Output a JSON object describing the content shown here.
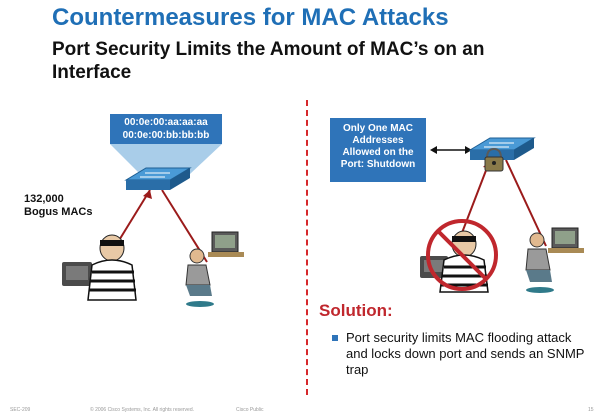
{
  "slide": {
    "title": "Countermeasures for MAC Attacks",
    "subtitle": "Port Security Limits the Amount of MAC’s on an Interface"
  },
  "left_panel": {
    "mac_table": [
      "00:0e:00:aa:aa:aa",
      "00:0e:00:bb:bb:bb"
    ],
    "attack_label_line1": "132,000",
    "attack_label_line2": "Bogus MACs"
  },
  "right_panel": {
    "callout_lines": [
      "Only One MAC",
      "Addresses",
      "Allowed on the",
      "Port: Shutdown"
    ],
    "solution_heading": "Solution:",
    "solution_bullet": "Port security limits MAC flooding attack and locks down port and sends an SNMP trap"
  },
  "footer": {
    "code": "SEC-209",
    "copyright": "© 2006 Cisco Systems, Inc. All rights reserved.",
    "classification": "Cisco Public",
    "page_number": "15"
  },
  "colors": {
    "title": "#1f6fb6",
    "callout": "#2f74b9",
    "accent_red": "#c0272d",
    "divider": "#d6282b"
  },
  "icons": [
    "switch-icon",
    "hacker-icon",
    "user-workstation-icon",
    "padlock-icon",
    "prohibited-icon",
    "double-arrow-icon"
  ]
}
